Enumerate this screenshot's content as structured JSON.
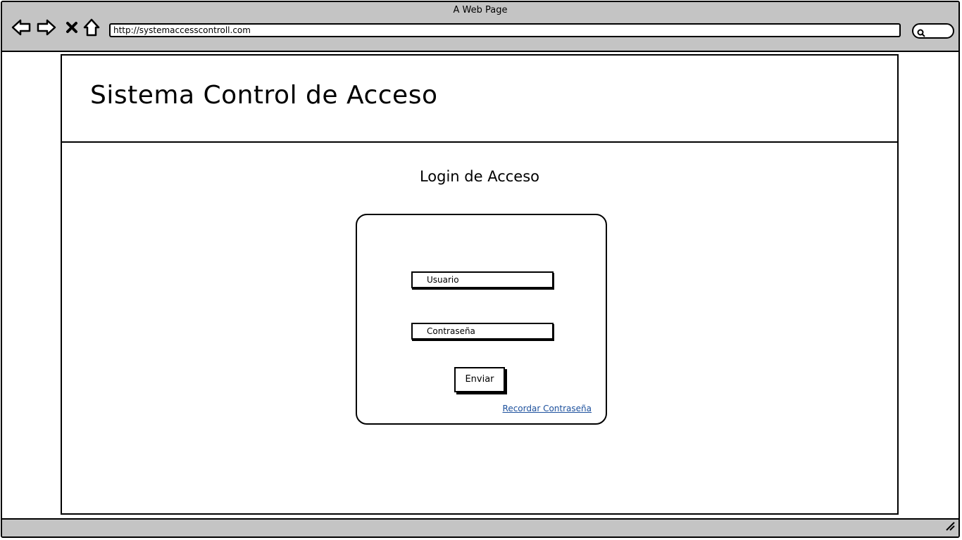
{
  "browser": {
    "window_title": "A Web Page",
    "url": "http://systemaccesscontroll.com",
    "nav_icons": [
      "back-arrow-icon",
      "forward-arrow-icon",
      "close-icon",
      "home-icon"
    ],
    "search_icon": "search-icon"
  },
  "header": {
    "title": "Sistema Control de Acceso"
  },
  "login": {
    "title": "Login de Acceso",
    "username_placeholder": "Usuario",
    "password_placeholder": "Contraseña",
    "submit_label": "Enviar",
    "forgot_link": "Recordar Contraseña"
  },
  "colors": {
    "chrome": "#c4c4c4",
    "link": "#1b4f9c"
  }
}
